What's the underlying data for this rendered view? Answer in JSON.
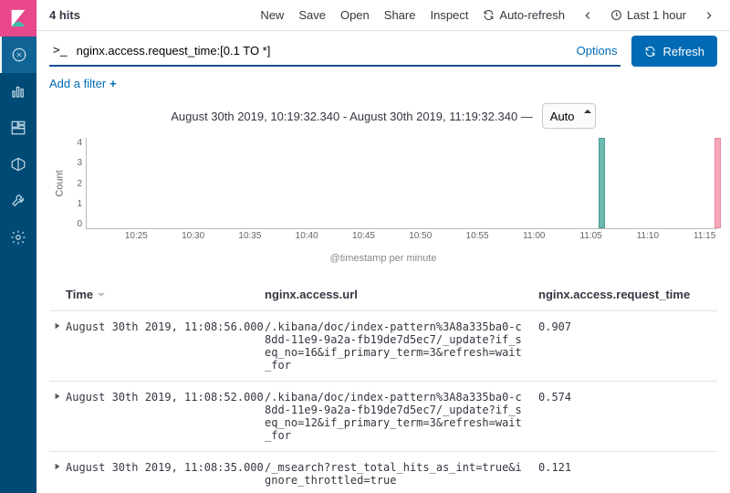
{
  "hits": "4 hits",
  "top_actions": {
    "new": "New",
    "save": "Save",
    "open": "Open",
    "share": "Share",
    "inspect": "Inspect",
    "auto_refresh": "Auto-refresh",
    "time_picker": "Last 1 hour"
  },
  "query": {
    "value": "nginx.access.request_time:[0.1 TO *]",
    "options": "Options",
    "refresh": "Refresh"
  },
  "filter": {
    "add": "Add a filter"
  },
  "histogram": {
    "range": "August 30th 2019, 10:19:32.340 - August 30th 2019, 11:19:32.340 —",
    "interval_options": [
      "Auto"
    ],
    "interval": "Auto",
    "ylabel": "Count",
    "xlabel": "@timestamp per minute",
    "yticks": [
      "4",
      "3",
      "2",
      "1",
      "0"
    ],
    "xticks": [
      "10:25",
      "10:30",
      "10:35",
      "10:40",
      "10:45",
      "10:50",
      "10:55",
      "11:00",
      "11:05",
      "11:10",
      "11:15"
    ]
  },
  "chart_data": {
    "type": "bar",
    "title": "",
    "xlabel": "@timestamp per minute",
    "ylabel": "Count",
    "ylim": [
      0,
      4
    ],
    "x_range": [
      "2019-08-30T10:19:32.340",
      "2019-08-30T11:19:32.340"
    ],
    "categories": [
      "11:08",
      "11:19"
    ],
    "values": [
      4,
      4
    ],
    "notes": "second bar at far-right rendered pink and partially clipped"
  },
  "columns": {
    "time": "Time",
    "url": "nginx.access.url",
    "rt": "nginx.access.request_time"
  },
  "rows": [
    {
      "time": "August 30th 2019, 11:08:56.000",
      "url": "/.kibana/doc/index-pattern%3A8a335ba0-c8dd-11e9-9a2a-fb19de7d5ec7/_update?if_seq_no=16&if_primary_term=3&refresh=wait_for",
      "rt": "0.907"
    },
    {
      "time": "August 30th 2019, 11:08:52.000",
      "url": "/.kibana/doc/index-pattern%3A8a335ba0-c8dd-11e9-9a2a-fb19de7d5ec7/_update?if_seq_no=12&if_primary_term=3&refresh=wait_for",
      "rt": "0.574"
    },
    {
      "time": "August 30th 2019, 11:08:35.000",
      "url": "/_msearch?rest_total_hits_as_int=true&ignore_throttled=true",
      "rt": "0.121"
    }
  ]
}
